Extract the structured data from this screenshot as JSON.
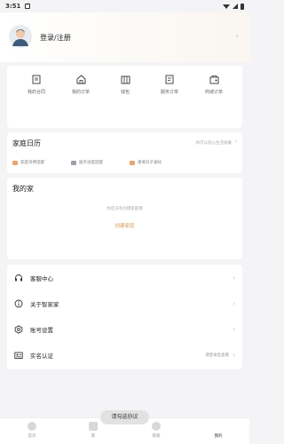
{
  "status_bar": {
    "time": "3:51"
  },
  "header": {
    "login_label": "登录/注册"
  },
  "quick_actions": [
    {
      "label": "我的合同",
      "icon": "contract-icon"
    },
    {
      "label": "我的订单",
      "icon": "home-order-icon"
    },
    {
      "label": "钱包",
      "icon": "wallet-icon"
    },
    {
      "label": "服务订单",
      "icon": "service-order-icon"
    },
    {
      "label": "商城订单",
      "icon": "shop-order-icon"
    }
  ],
  "calendar": {
    "title": "家庭日历",
    "hint": "你可以放心生活备餐",
    "items": [
      {
        "label": "家庭消费提醒",
        "icon": "megaphone-icon",
        "color": "#e9a46e"
      },
      {
        "label": "服务进度提醒",
        "icon": "truck-icon",
        "color": "#9aa0a8"
      },
      {
        "label": "重要日子通知",
        "icon": "gift-icon",
        "color": "#e9a46e"
      }
    ]
  },
  "my_home": {
    "title": "我的家",
    "empty_text": "你还没有创建家庭哦",
    "create_label": "创建家庭"
  },
  "menu": [
    {
      "label": "客服中心",
      "icon": "headset-icon",
      "hint": ""
    },
    {
      "label": "关于智家家",
      "icon": "info-icon",
      "hint": ""
    },
    {
      "label": "账号设置",
      "icon": "gear-icon",
      "hint": ""
    },
    {
      "label": "实名认证",
      "icon": "id-card-icon",
      "hint": "请登录后查看"
    }
  ],
  "tabbar": [
    {
      "label": "首页",
      "icon": "home-tab-icon"
    },
    {
      "label": "家",
      "icon": "house-tab-icon"
    },
    {
      "label": "管家",
      "icon": "butler-tab-icon"
    },
    {
      "label": "我的",
      "icon": "profile-tab-icon"
    }
  ],
  "toast": "请勾选协议"
}
